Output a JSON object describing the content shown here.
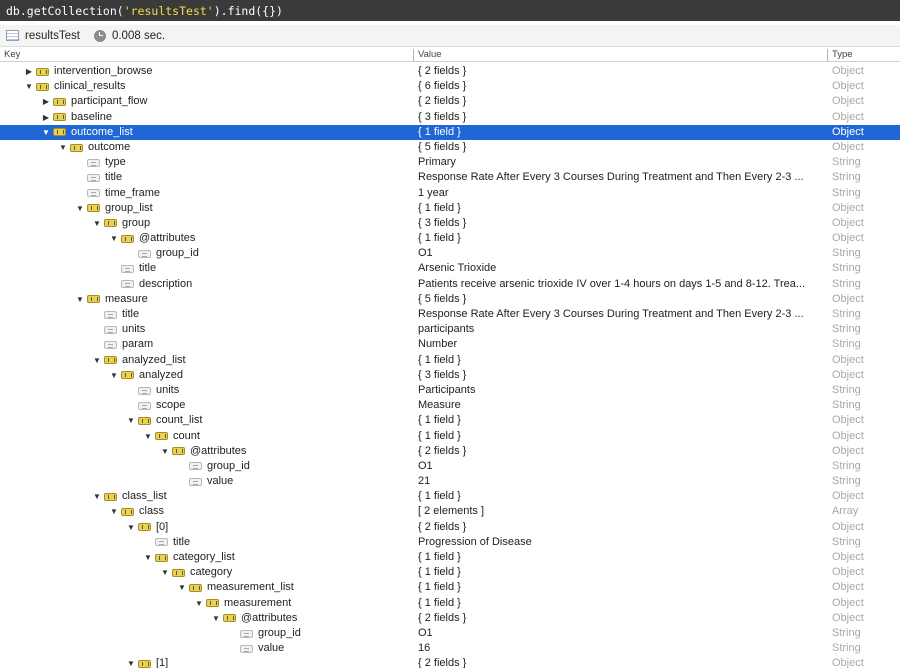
{
  "query": {
    "prefix": "db.getCollection(",
    "collection_literal": "'resultsTest'",
    "suffix": ").find({})"
  },
  "info": {
    "collection": "resultsTest",
    "time": "0.008 sec."
  },
  "columns": {
    "key": "Key",
    "value": "Value",
    "type": "Type"
  },
  "rows": [
    {
      "key": "intervention_browse",
      "value": "{ 2 fields }",
      "type": "Object",
      "depth": 1,
      "arrow": "collapsed",
      "icon": "object"
    },
    {
      "key": "clinical_results",
      "value": "{ 6 fields }",
      "type": "Object",
      "depth": 1,
      "arrow": "expanded",
      "icon": "object"
    },
    {
      "key": "participant_flow",
      "value": "{ 2 fields }",
      "type": "Object",
      "depth": 2,
      "arrow": "collapsed",
      "icon": "object"
    },
    {
      "key": "baseline",
      "value": "{ 3 fields }",
      "type": "Object",
      "depth": 2,
      "arrow": "collapsed",
      "icon": "object"
    },
    {
      "key": "outcome_list",
      "value": "{ 1 field }",
      "type": "Object",
      "depth": 2,
      "arrow": "expanded",
      "icon": "object",
      "selected": true
    },
    {
      "key": "outcome",
      "value": "{ 5 fields }",
      "type": "Object",
      "depth": 3,
      "arrow": "expanded",
      "icon": "object"
    },
    {
      "key": "type",
      "value": "Primary",
      "type": "String",
      "depth": 4,
      "arrow": "none",
      "icon": "string"
    },
    {
      "key": "title",
      "value": "Response Rate After Every 3 Courses During Treatment and Then Every 2-3 ...",
      "type": "String",
      "depth": 4,
      "arrow": "none",
      "icon": "string"
    },
    {
      "key": "time_frame",
      "value": "1 year",
      "type": "String",
      "depth": 4,
      "arrow": "none",
      "icon": "string"
    },
    {
      "key": "group_list",
      "value": "{ 1 field }",
      "type": "Object",
      "depth": 4,
      "arrow": "expanded",
      "icon": "object"
    },
    {
      "key": "group",
      "value": "{ 3 fields }",
      "type": "Object",
      "depth": 5,
      "arrow": "expanded",
      "icon": "object"
    },
    {
      "key": "@attributes",
      "value": "{ 1 field }",
      "type": "Object",
      "depth": 6,
      "arrow": "expanded",
      "icon": "object"
    },
    {
      "key": "group_id",
      "value": "O1",
      "type": "String",
      "depth": 7,
      "arrow": "none",
      "icon": "string"
    },
    {
      "key": "title",
      "value": "Arsenic Trioxide",
      "type": "String",
      "depth": 6,
      "arrow": "none",
      "icon": "string"
    },
    {
      "key": "description",
      "value": "Patients receive arsenic trioxide IV over 1-4 hours on days 1-5 and 8-12. Trea...",
      "type": "String",
      "depth": 6,
      "arrow": "none",
      "icon": "string"
    },
    {
      "key": "measure",
      "value": "{ 5 fields }",
      "type": "Object",
      "depth": 4,
      "arrow": "expanded",
      "icon": "object"
    },
    {
      "key": "title",
      "value": "Response Rate After Every 3 Courses During Treatment and Then Every 2-3 ...",
      "type": "String",
      "depth": 5,
      "arrow": "none",
      "icon": "string"
    },
    {
      "key": "units",
      "value": "participants",
      "type": "String",
      "depth": 5,
      "arrow": "none",
      "icon": "string"
    },
    {
      "key": "param",
      "value": "Number",
      "type": "String",
      "depth": 5,
      "arrow": "none",
      "icon": "string"
    },
    {
      "key": "analyzed_list",
      "value": "{ 1 field }",
      "type": "Object",
      "depth": 5,
      "arrow": "expanded",
      "icon": "object"
    },
    {
      "key": "analyzed",
      "value": "{ 3 fields }",
      "type": "Object",
      "depth": 6,
      "arrow": "expanded",
      "icon": "object"
    },
    {
      "key": "units",
      "value": "Participants",
      "type": "String",
      "depth": 7,
      "arrow": "none",
      "icon": "string"
    },
    {
      "key": "scope",
      "value": "Measure",
      "type": "String",
      "depth": 7,
      "arrow": "none",
      "icon": "string"
    },
    {
      "key": "count_list",
      "value": "{ 1 field }",
      "type": "Object",
      "depth": 7,
      "arrow": "expanded",
      "icon": "object"
    },
    {
      "key": "count",
      "value": "{ 1 field }",
      "type": "Object",
      "depth": 8,
      "arrow": "expanded",
      "icon": "object"
    },
    {
      "key": "@attributes",
      "value": "{ 2 fields }",
      "type": "Object",
      "depth": 9,
      "arrow": "expanded",
      "icon": "object"
    },
    {
      "key": "group_id",
      "value": "O1",
      "type": "String",
      "depth": 10,
      "arrow": "none",
      "icon": "string"
    },
    {
      "key": "value",
      "value": "21",
      "type": "String",
      "depth": 10,
      "arrow": "none",
      "icon": "string"
    },
    {
      "key": "class_list",
      "value": "{ 1 field }",
      "type": "Object",
      "depth": 5,
      "arrow": "expanded",
      "icon": "object"
    },
    {
      "key": "class",
      "value": "[ 2 elements ]",
      "type": "Array",
      "depth": 6,
      "arrow": "expanded",
      "icon": "object"
    },
    {
      "key": "[0]",
      "value": "{ 2 fields }",
      "type": "Object",
      "depth": 7,
      "arrow": "expanded",
      "icon": "object"
    },
    {
      "key": "title",
      "value": "Progression of Disease",
      "type": "String",
      "depth": 8,
      "arrow": "none",
      "icon": "string"
    },
    {
      "key": "category_list",
      "value": "{ 1 field }",
      "type": "Object",
      "depth": 8,
      "arrow": "expanded",
      "icon": "object"
    },
    {
      "key": "category",
      "value": "{ 1 field }",
      "type": "Object",
      "depth": 9,
      "arrow": "expanded",
      "icon": "object"
    },
    {
      "key": "measurement_list",
      "value": "{ 1 field }",
      "type": "Object",
      "depth": 10,
      "arrow": "expanded",
      "icon": "object"
    },
    {
      "key": "measurement",
      "value": "{ 1 field }",
      "type": "Object",
      "depth": 11,
      "arrow": "expanded",
      "icon": "object"
    },
    {
      "key": "@attributes",
      "value": "{ 2 fields }",
      "type": "Object",
      "depth": 12,
      "arrow": "expanded",
      "icon": "object"
    },
    {
      "key": "group_id",
      "value": "O1",
      "type": "String",
      "depth": 13,
      "arrow": "none",
      "icon": "string"
    },
    {
      "key": "value",
      "value": "16",
      "type": "String",
      "depth": 13,
      "arrow": "none",
      "icon": "string"
    },
    {
      "key": "[1]",
      "value": "{ 2 fields }",
      "type": "Object",
      "depth": 7,
      "arrow": "expanded",
      "icon": "object"
    }
  ]
}
